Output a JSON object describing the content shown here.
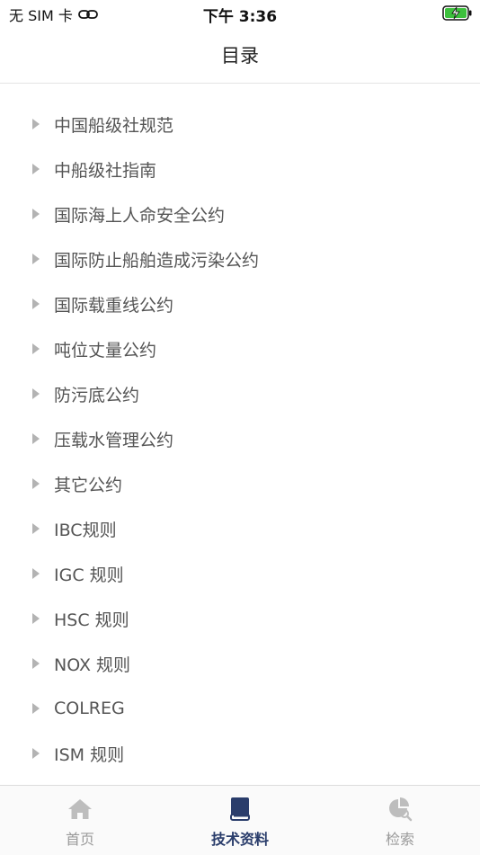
{
  "status_bar": {
    "carrier": "无 SIM 卡",
    "time": "下午 3:36"
  },
  "nav": {
    "title": "目录"
  },
  "catalog": {
    "items": [
      "中国船级社规范",
      "中船级社指南",
      "国际海上人命安全公约",
      "国际防止船舶造成污染公约",
      "国际载重线公约",
      "吨位丈量公约",
      "防污底公约",
      "压载水管理公约",
      "其它公约",
      "IBC规则",
      "IGC 规则",
      "HSC 规则",
      "NOX 规则",
      "COLREG",
      "ISM 规则"
    ]
  },
  "tabs": [
    {
      "label": "首页",
      "icon": "home-icon",
      "active": false
    },
    {
      "label": "技术资料",
      "icon": "book-icon",
      "active": true
    },
    {
      "label": "检索",
      "icon": "search-chart-icon",
      "active": false
    }
  ],
  "colors": {
    "active_tab": "#2a3d6b",
    "inactive_tab": "#bdbdbd",
    "battery": "#3cc03c"
  }
}
